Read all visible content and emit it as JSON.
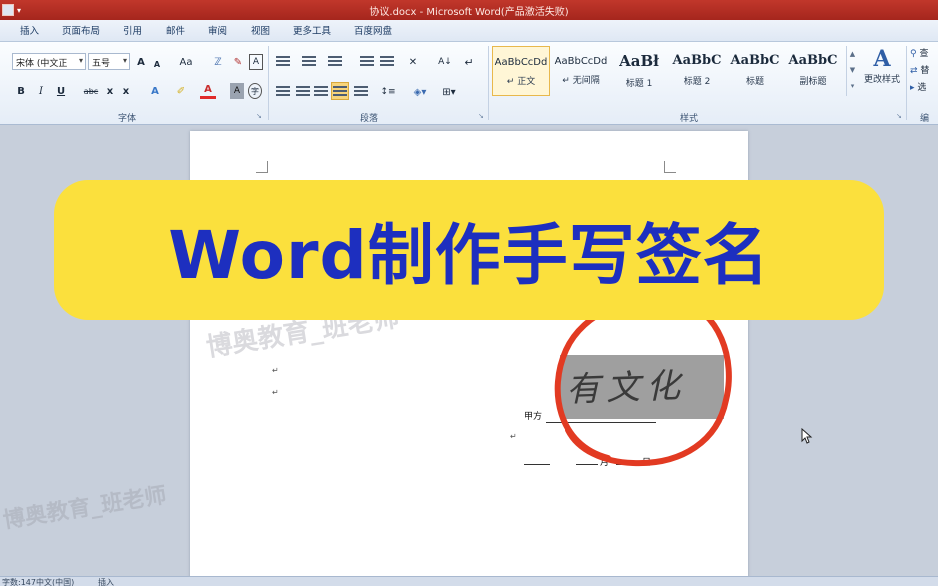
{
  "window": {
    "title": "协议.docx - Microsoft Word(产品激活失败)"
  },
  "tabs": [
    "插入",
    "页面布局",
    "引用",
    "邮件",
    "审阅",
    "视图",
    "更多工具",
    "百度网盘"
  ],
  "font_group": {
    "font_name": "宋体 (中文正",
    "font_size": "五号",
    "grow": "A",
    "shrink": "A",
    "case": "Aa",
    "bold": "B",
    "italic": "I",
    "underline": "U",
    "strike": "abc",
    "subscript": "x",
    "superscript": "x",
    "label": "字体"
  },
  "paragraph_group": {
    "label": "段落"
  },
  "styles_group": {
    "label": "样式",
    "cards": [
      {
        "sample": "AaBbCcDd",
        "name": "↵ 正文"
      },
      {
        "sample": "AaBbCcDd",
        "name": "↵ 无间隔"
      },
      {
        "sample": "AaBł",
        "name": "标题 1"
      },
      {
        "sample": "AaBbC",
        "name": "标题 2"
      },
      {
        "sample": "AaBbC",
        "name": "标题"
      },
      {
        "sample": "AaBbC",
        "name": "副标题"
      }
    ],
    "change_styles_label": "更改样式"
  },
  "edit_group": {
    "items": [
      "查",
      "替",
      "选"
    ],
    "label": "编"
  },
  "banner": {
    "text": "Word制作手写签名"
  },
  "watermarks": [
    "博奥教育_班老师",
    "博奥教育_班老师"
  ],
  "document": {
    "party_label": "甲方",
    "date_month": "月",
    "date_day": "日",
    "signature": "有文化",
    "para_mark": "↵"
  },
  "status_bar": {
    "words": "字数:147",
    "lang": "中文(中国)",
    "mode": "插入"
  },
  "colors": {
    "banner_bg": "#fbe03d",
    "banner_text": "#1d2fbf",
    "circle": "#e23a22",
    "title_bar": "#b52e22"
  }
}
